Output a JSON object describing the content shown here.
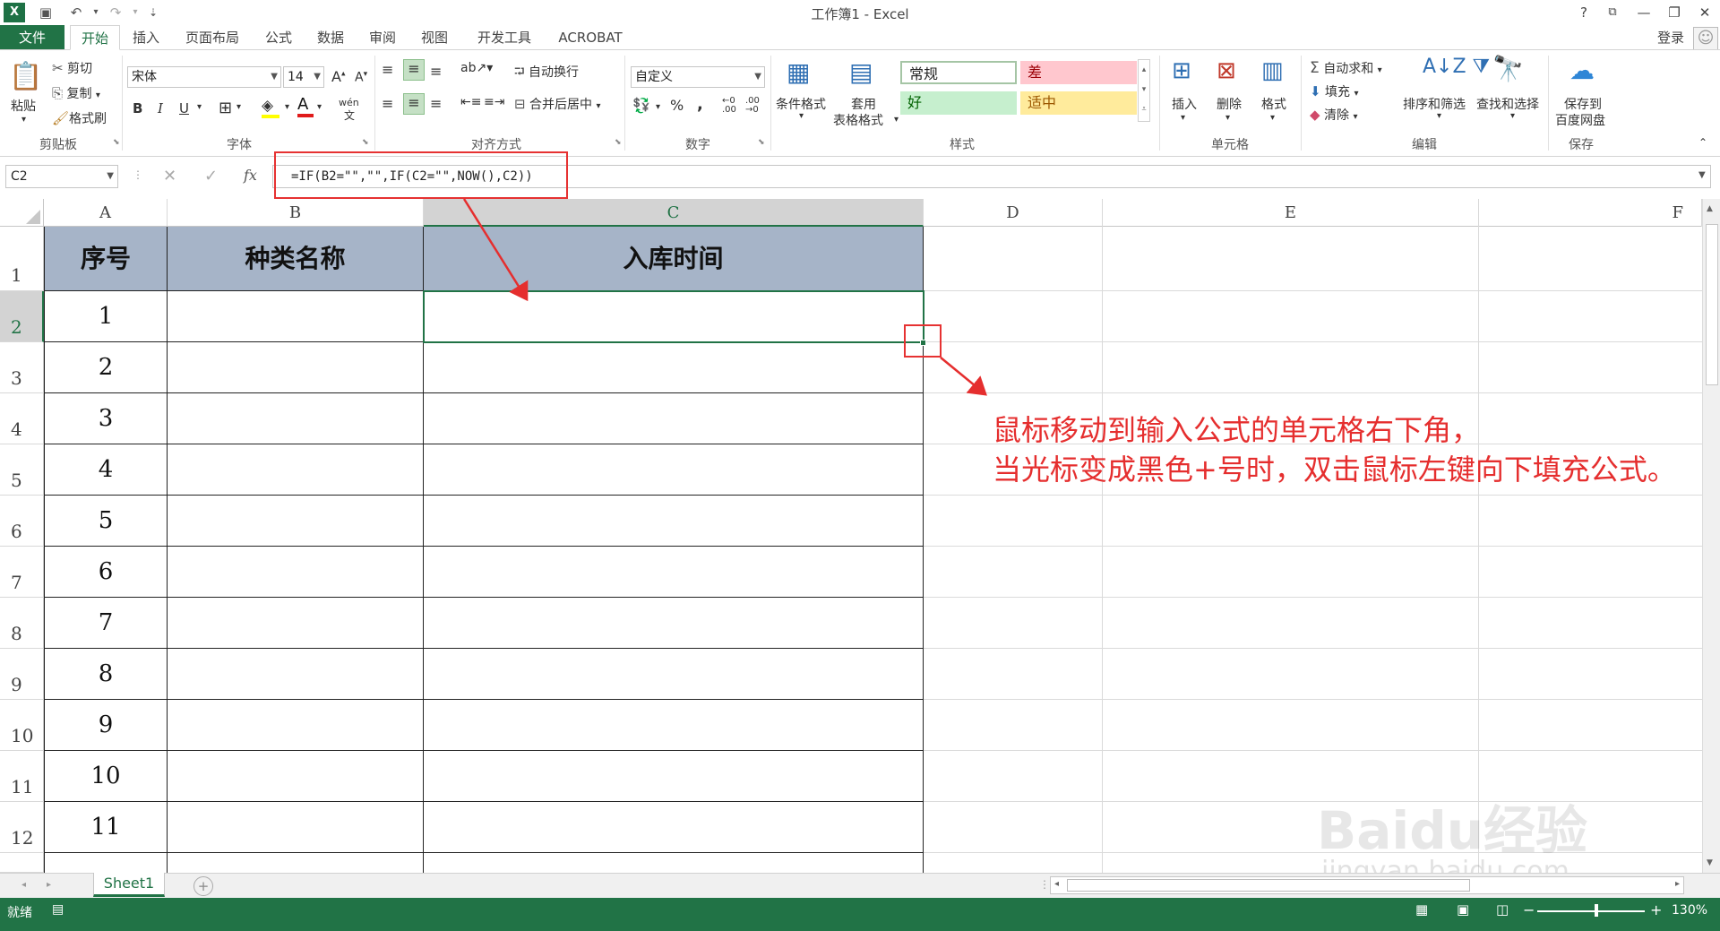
{
  "window": {
    "title": "工作簿1 - Excel",
    "help": "?",
    "controls": [
      "—",
      "❐",
      "✕"
    ]
  },
  "tabs": [
    "文件",
    "开始",
    "插入",
    "页面布局",
    "公式",
    "数据",
    "审阅",
    "视图",
    "开发工具",
    "ACROBAT"
  ],
  "account": {
    "login": "登录"
  },
  "ribbon": {
    "clipboard": {
      "label": "剪贴板",
      "paste": "粘贴",
      "cut": "剪切",
      "copy": "复制",
      "format_painter": "格式刷"
    },
    "font": {
      "label": "字体",
      "name": "宋体",
      "size": "14",
      "bold": "B",
      "italic": "I",
      "underline": "U",
      "wen": "wén"
    },
    "alignment": {
      "label": "对齐方式",
      "wrap": "自动换行",
      "merge": "合并后居中"
    },
    "number": {
      "label": "数字",
      "format": "自定义",
      "percent": "%",
      "comma": ","
    },
    "styles": {
      "label": "样式",
      "cond_format": "条件格式",
      "table_format_1": "套用",
      "table_format_2": "表格格式",
      "normal": "常规",
      "bad": "差",
      "good": "好",
      "neutral": "适中"
    },
    "cells": {
      "label": "单元格",
      "insert": "插入",
      "delete": "删除",
      "format": "格式"
    },
    "editing": {
      "label": "编辑",
      "autosum": "自动求和",
      "fill": "填充",
      "clear": "清除",
      "sort": "排序和筛选",
      "find": "查找和选择"
    },
    "save": {
      "label": "保存",
      "save_to_1": "保存到",
      "save_to_2": "百度网盘"
    }
  },
  "formula_bar": {
    "name_box": "C2",
    "fx": "fx",
    "formula": "=IF(B2=\"\",\"\",IF(C2=\"\",NOW(),C2))"
  },
  "columns": [
    "A",
    "B",
    "C",
    "D",
    "E",
    "F"
  ],
  "rows": [
    "1",
    "2",
    "3",
    "4",
    "5",
    "6",
    "7",
    "8",
    "9",
    "10",
    "11",
    "12"
  ],
  "table": {
    "headers": [
      "序号",
      "种类名称",
      "入库时间"
    ],
    "serials": [
      "1",
      "2",
      "3",
      "4",
      "5",
      "6",
      "7",
      "8",
      "9",
      "10",
      "11"
    ]
  },
  "annotation": {
    "line1": "鼠标移动到输入公式的单元格右下角，",
    "line2": "当光标变成黑色+号时，双击鼠标左键向下填充公式。"
  },
  "sheet_tabs": [
    "Sheet1"
  ],
  "status": {
    "ready": "就绪",
    "zoom": "130%"
  },
  "watermark": {
    "brand": "Baidu经验",
    "url": "jingyan.baidu.com"
  },
  "colors": {
    "accent": "#217346",
    "header_fill": "#a6b4c8",
    "annotation": "#e52e2e"
  }
}
